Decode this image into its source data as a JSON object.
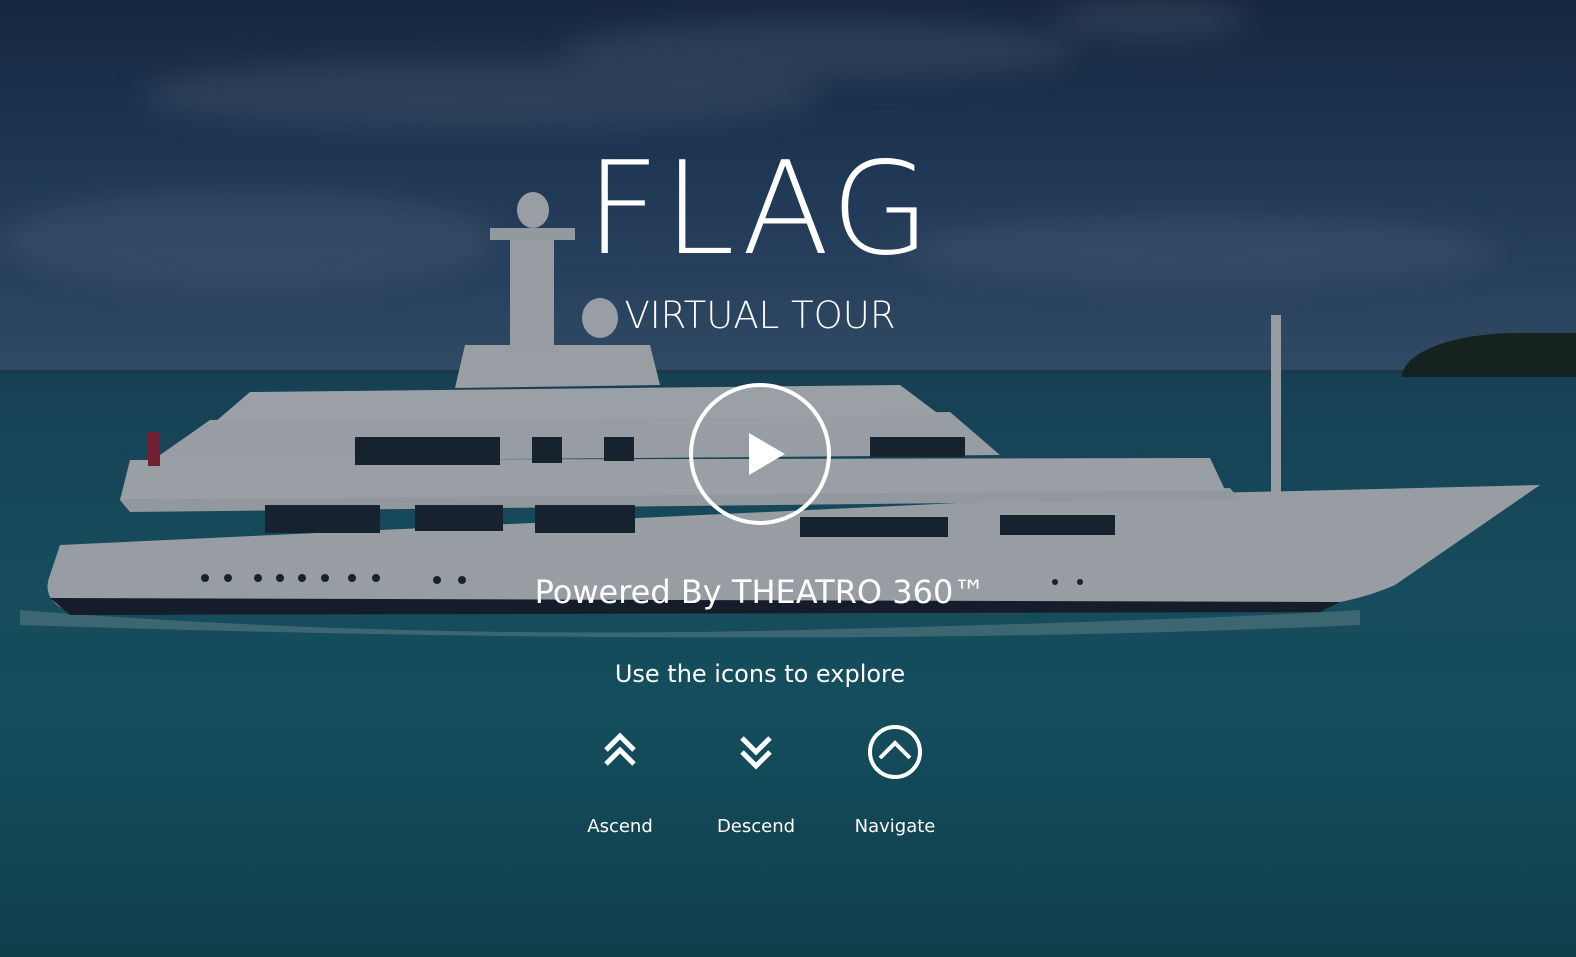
{
  "hero": {
    "title": "FLAG",
    "subtitle": "VIRTUAL TOUR",
    "play_icon": "play-icon"
  },
  "footer": {
    "powered_by": "Powered By THEATRO 360™",
    "instructions": "Use the icons to explore"
  },
  "controls": [
    {
      "label": "Ascend",
      "icon": "double-chevron-up-icon"
    },
    {
      "label": "Descend",
      "icon": "double-chevron-down-icon"
    },
    {
      "label": "Navigate",
      "icon": "circle-chevron-up-icon"
    }
  ],
  "colors": {
    "text": "#ffffff",
    "overlay": "#0a1423"
  }
}
